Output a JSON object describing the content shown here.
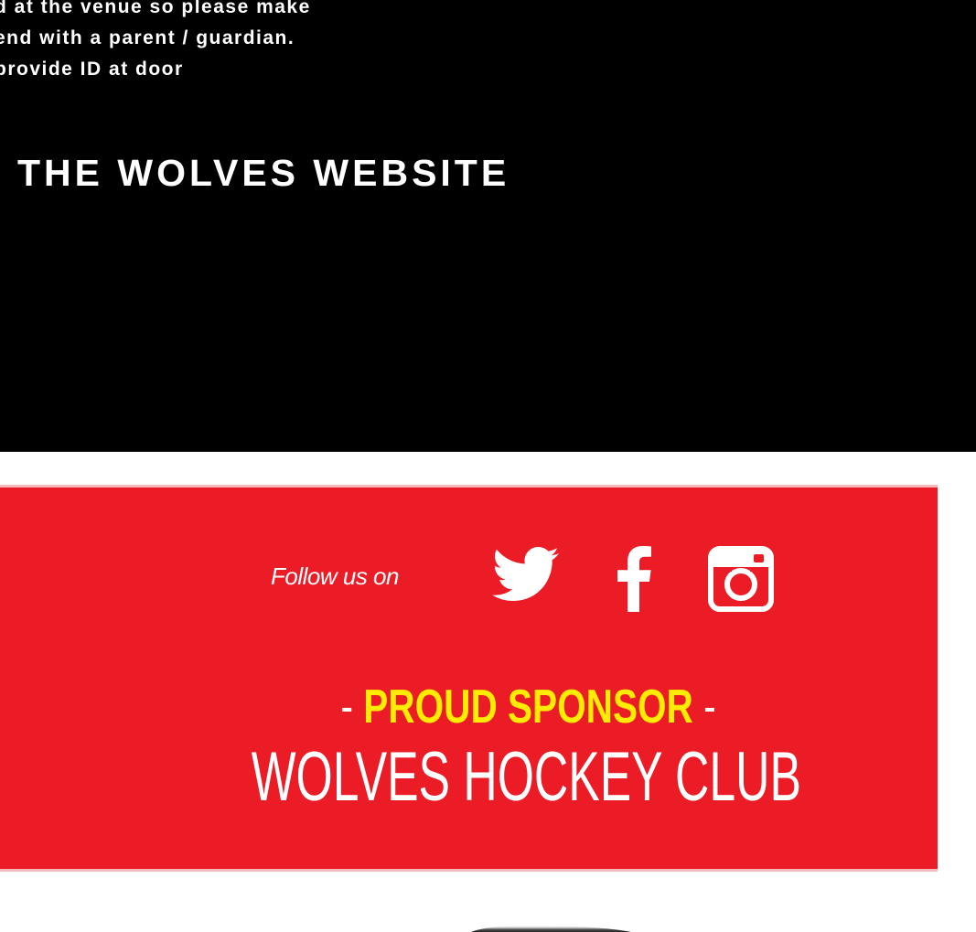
{
  "notice": {
    "lines": [
      "d at the venue so please make",
      "end with a parent / guardian.",
      "provide ID at door"
    ]
  },
  "website_link": "THE WOLVES WEBSITE",
  "banner": {
    "follow_label": "Follow us on",
    "social_icons": [
      "twitter-icon",
      "facebook-icon",
      "instagram-icon"
    ],
    "sponsor_tag": "PROUD SPONSOR",
    "sponsor_dash": "-",
    "club_name": "WOLVES HOCKEY CLUB"
  },
  "colors": {
    "background_top": "#000000",
    "banner_red": "#ec1c27",
    "banner_border": "#f6b9bc",
    "sponsor_yellow": "#ffec00",
    "text_white": "#ffffff"
  }
}
